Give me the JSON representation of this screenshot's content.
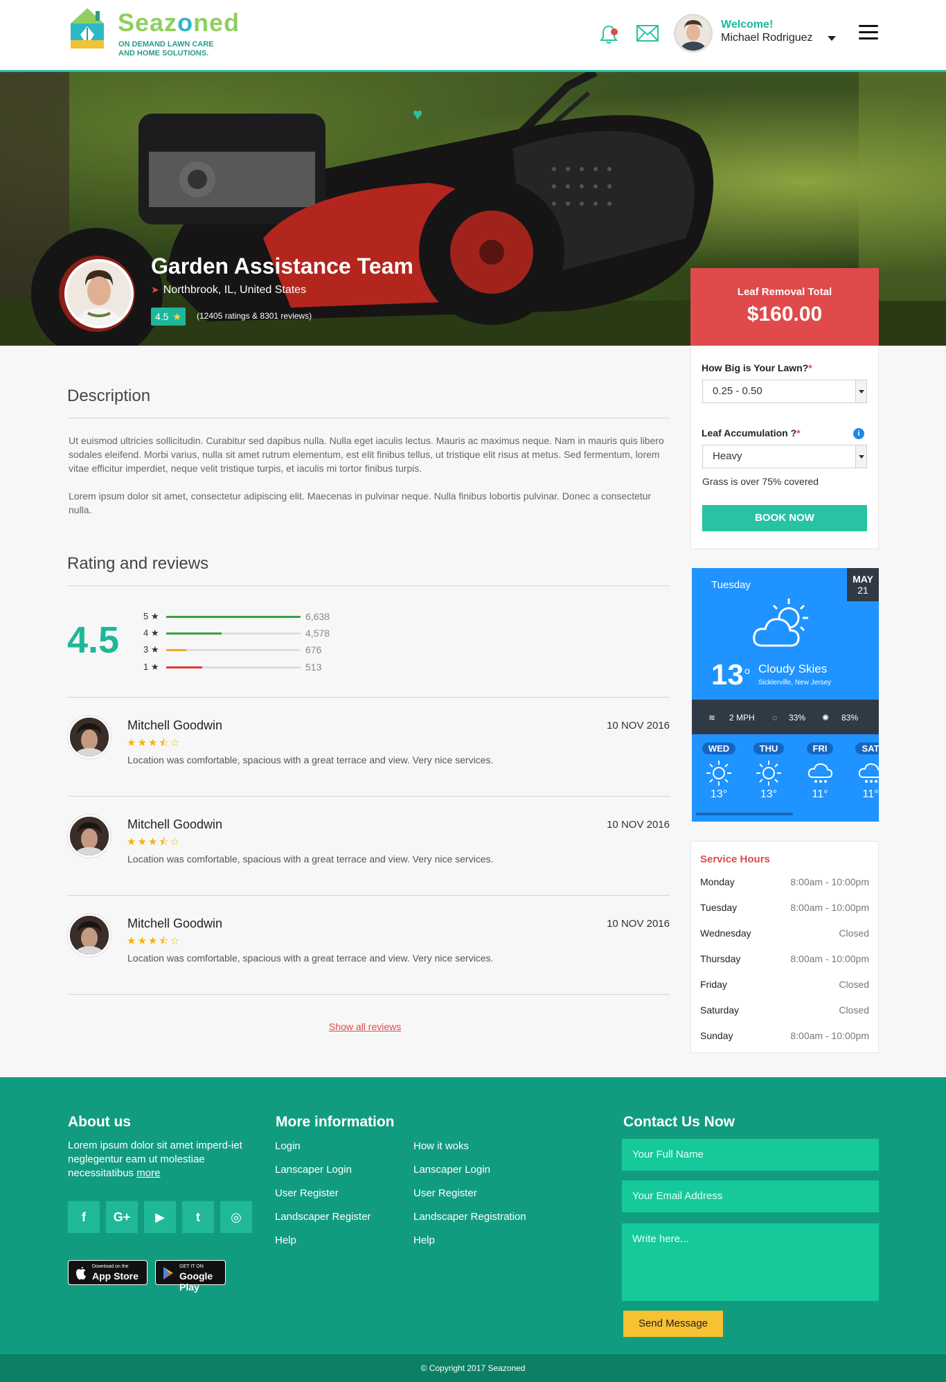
{
  "header": {
    "logo_name_a": "Seaz",
    "logo_name_b": "o",
    "logo_name_c": "ned",
    "logo_tagline_1": "ON DEMAND LAWN CARE",
    "logo_tagline_2": "AND HOME SOLUTIONS.",
    "welcome": "Welcome!",
    "user_name": "Michael Rodriguez"
  },
  "hero": {
    "title": "Garden Assistance Team",
    "location": "Northbrook, IL, United States",
    "rating": "4.5",
    "rating_star": "★",
    "rating_count": "(12405 ratings & 8301 reviews)"
  },
  "booking": {
    "head_label": "Leaf Removal Total",
    "price": "$160.00",
    "lawn_label": "How Big is Your Lawn?",
    "lawn_value": "0.25 - 0.50",
    "leaf_label": "Leaf Accumulation ?",
    "leaf_value": "Heavy",
    "leaf_note": "Grass is over 75% covered",
    "required_mark": "*",
    "info_icon": "i",
    "book_button": "BOOK NOW"
  },
  "weather": {
    "day": "Tuesday",
    "month": "MAY",
    "date": "21",
    "temp": "13",
    "deg": "o",
    "condition": "Cloudy Skies",
    "place": "Sicklerville, New Jersey",
    "wind": "2 MPH",
    "rain": "33%",
    "humidity": "83%",
    "forecast": [
      {
        "day": "WED",
        "temp": "13°",
        "icon": "sun-icon"
      },
      {
        "day": "THU",
        "temp": "13°",
        "icon": "sun-icon"
      },
      {
        "day": "FRI",
        "temp": "11°",
        "icon": "snow-cloud-icon"
      },
      {
        "day": "SAT",
        "temp": "11°",
        "icon": "snow-cloud-icon"
      }
    ]
  },
  "hours": {
    "title": "Service Hours",
    "rows": [
      {
        "day": "Monday",
        "time": "8:00am - 10:00pm"
      },
      {
        "day": "Tuesday",
        "time": "8:00am - 10:00pm"
      },
      {
        "day": "Wednesday",
        "time": "Closed"
      },
      {
        "day": "Thursday",
        "time": "8:00am - 10:00pm"
      },
      {
        "day": "Friday",
        "time": "Closed"
      },
      {
        "day": "Saturday",
        "time": "Closed"
      },
      {
        "day": "Sunday",
        "time": "8:00am - 10:00pm"
      }
    ]
  },
  "description": {
    "title": "Description",
    "p1": "Ut euismod ultricies sollicitudin. Curabitur sed dapibus nulla. Nulla eget iaculis lectus. Mauris ac maximus neque. Nam in mauris quis libero sodales eleifend. Morbi varius, nulla sit amet rutrum elementum, est elit finibus tellus, ut tristique elit risus at metus. Sed fermentum, lorem vitae efficitur imperdiet, neque velit tristique turpis, et iaculis mi tortor finibus turpis.",
    "p2": "Lorem ipsum dolor sit amet, consectetur adipiscing elit. Maecenas in pulvinar neque. Nulla finibus lobortis pulvinar. Donec a consectetur nulla."
  },
  "ratings": {
    "title": "Rating and reviews",
    "overall": "4.5",
    "bars": [
      {
        "label": "5 ★",
        "count": "6,638",
        "fraction": 1.0,
        "color": "#3aa03f"
      },
      {
        "label": "4 ★",
        "count": "4,578",
        "fraction": 0.41,
        "color": "#3aa03f"
      },
      {
        "label": "3 ★",
        "count": "676",
        "fraction": 0.15,
        "color": "#f5a623"
      },
      {
        "label": "1 ★",
        "count": "513",
        "fraction": 0.27,
        "color": "#e53935"
      }
    ]
  },
  "reviews": [
    {
      "name": "Mitchell Goodwin",
      "date": "10 NOV 2016",
      "stars": "★★★⯪☆",
      "rating": 3.5,
      "text": "Location was comfortable, spacious with a great terrace and view. Very nice services."
    },
    {
      "name": "Mitchell Goodwin",
      "date": "10 NOV 2016",
      "stars": "★★★⯪☆",
      "rating": 3.5,
      "text": "Location was comfortable, spacious with a great terrace and view. Very nice services."
    },
    {
      "name": "Mitchell Goodwin",
      "date": "10 NOV 2016",
      "stars": "★★★⯪☆",
      "rating": 3.5,
      "text": "Location was comfortable, spacious with a great terrace and view. Very nice services."
    }
  ],
  "show_all": "Show all reviews",
  "footer": {
    "about_title": "About us",
    "about_text": "Lorem ipsum dolor sit amet imperd-iet neglegentur eam ut molestiae necessitatibus",
    "about_more": "more",
    "social": [
      {
        "icon": "facebook-icon",
        "glyph": "f"
      },
      {
        "icon": "google-plus-icon",
        "glyph": "G+"
      },
      {
        "icon": "youtube-icon",
        "glyph": "▶"
      },
      {
        "icon": "twitter-icon",
        "glyph": "t"
      },
      {
        "icon": "instagram-icon",
        "glyph": "◎"
      }
    ],
    "appstore_small": "Download on the",
    "appstore_big": "App Store",
    "googleplay_small": "GET IT ON",
    "googleplay_big": "Google Play",
    "more_title": "More information",
    "links_col1": [
      "Login",
      "Lanscaper Login",
      "User Register",
      "Landscaper Register",
      "Help"
    ],
    "links_col2": [
      "How it woks",
      "Lanscaper Login",
      "User Register",
      "Landscaper Registration",
      "Help"
    ],
    "contact_title": "Contact Us Now",
    "name_placeholder": "Your Full Name",
    "email_placeholder": "Your Email Address",
    "message_placeholder": "Write here...",
    "send_button": "Send Message",
    "copyright": "© Copyright 2017 Seazoned"
  },
  "colors": {
    "accent": "#27c3a3",
    "red": "#e04a4a",
    "footer": "#129c7f",
    "weather": "#1f93ff"
  }
}
